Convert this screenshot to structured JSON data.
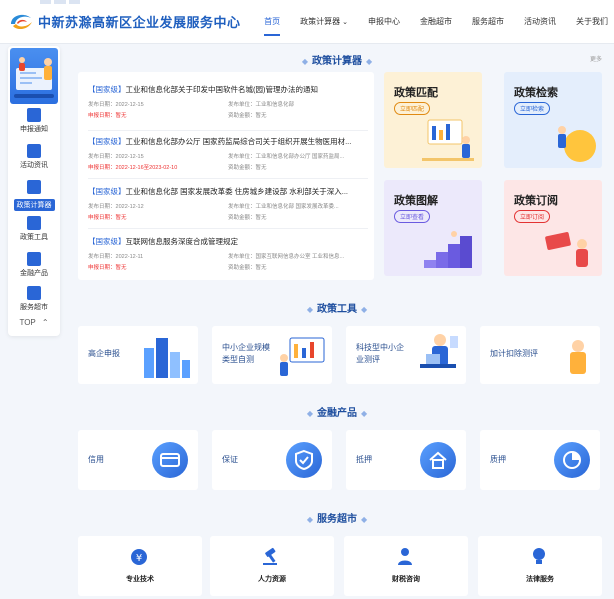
{
  "header": {
    "title": "中新苏滁高新区企业发展服务中心",
    "nav": [
      {
        "label": "首页",
        "active": true
      },
      {
        "label": "政策计算器",
        "caret": "⌄"
      },
      {
        "label": "申报中心"
      },
      {
        "label": "金融超市"
      },
      {
        "label": "服务超市"
      },
      {
        "label": "活动资讯"
      },
      {
        "label": "关于我们"
      }
    ]
  },
  "sidebar": {
    "items": [
      {
        "label": "申报通知"
      },
      {
        "label": "活动资讯"
      },
      {
        "label": "政策计算器",
        "active": true
      },
      {
        "label": "政策工具"
      },
      {
        "label": "金融产品"
      },
      {
        "label": "服务超市"
      }
    ],
    "top_label": "TOP",
    "top_arrow": "⌃"
  },
  "calculator": {
    "title": "政策计算器",
    "more": "更多",
    "news": [
      {
        "tag": "【国家级】",
        "title": "工业和信息化部关于印发中国软件名城(园)管理办法的通知",
        "date_label": "发布日期：",
        "date": "2022-12-15",
        "unit_label": "发布单位：",
        "unit": "工业和信息化部",
        "period_label": "申报日期：",
        "period": "暂无",
        "amount_label": "资助金额：",
        "amount": "暂无"
      },
      {
        "tag": "【国家级】",
        "title": "工业和信息化部办公厅 国家药监局综合司关于组织开展生物医用材...",
        "date_label": "发布日期：",
        "date": "2022-12-15",
        "unit_label": "发布单位：",
        "unit": "工业和信息化部办公厅 国家药监局...",
        "period_label": "申报日期：",
        "period": "2022-12-16至2023-02-10",
        "amount_label": "资助金额：",
        "amount": "暂无"
      },
      {
        "tag": "【国家级】",
        "title": "工业和信息化部 国家发展改革委 住房城乡建设部 水利部关于深入...",
        "date_label": "发布日期：",
        "date": "2022-12-12",
        "unit_label": "发布单位：",
        "unit": "工业和信息化部 国家发展改革委...",
        "period_label": "申报日期：",
        "period": "暂无",
        "amount_label": "资助金额：",
        "amount": "暂无"
      },
      {
        "tag": "【国家级】",
        "title": "互联网信息服务深度合成管理规定",
        "date_label": "发布日期：",
        "date": "2022-12-11",
        "unit_label": "发布单位：",
        "unit": "国家互联网信息办公室 工业和信息...",
        "period_label": "申报日期：",
        "period": "暂无",
        "amount_label": "资助金额：",
        "amount": "暂无"
      }
    ],
    "cards": [
      {
        "title": "政策匹配",
        "button": "立即匹配"
      },
      {
        "title": "政策检索",
        "button": "立即检索"
      },
      {
        "title": "政策图解",
        "button": "立即查看"
      },
      {
        "title": "政策订阅",
        "button": "立即订阅"
      }
    ]
  },
  "tools": {
    "title": "政策工具",
    "items": [
      {
        "label": "高企申报"
      },
      {
        "label": "中小企业规模\n类型自测"
      },
      {
        "label": "科技型中小企\n业测评"
      },
      {
        "label": "加计扣除测评"
      }
    ]
  },
  "finance": {
    "title": "金融产品",
    "items": [
      {
        "label": "信用"
      },
      {
        "label": "保证"
      },
      {
        "label": "抵押"
      },
      {
        "label": "质押"
      }
    ]
  },
  "services": {
    "title": "服务超市",
    "items": [
      {
        "label": "专业技术"
      },
      {
        "label": "人力资源"
      },
      {
        "label": "财税咨询"
      },
      {
        "label": "法律服务"
      }
    ]
  },
  "colors": {
    "primary": "#2a66d6",
    "brand_title": "#1f5fbf",
    "card_match": "#fdf1d6",
    "card_search": "#e4eefc",
    "card_graph": "#ece9fb",
    "card_subscribe": "#fde6e6",
    "red": "#e33333"
  }
}
